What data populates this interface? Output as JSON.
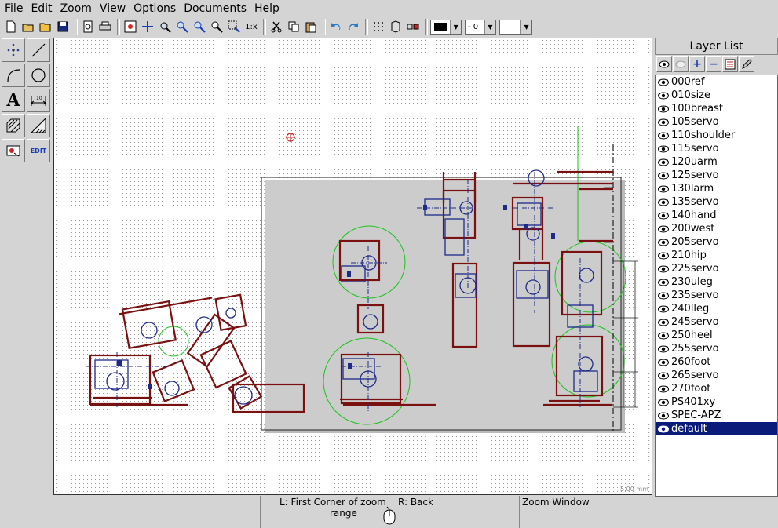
{
  "menu": [
    "File",
    "Edit",
    "Zoom",
    "View",
    "Options",
    "Documents",
    "Help"
  ],
  "toolbar": {
    "zoom_ratio_label": "1:x",
    "line_width_value": "0",
    "icons": [
      "new-icon",
      "open-icon",
      "open-folder-icon",
      "save-icon",
      "print-preview-icon",
      "print-icon",
      "zoom-auto-icon",
      "zoom-pan-icon",
      "zoom-page-icon",
      "zoom-in-icon",
      "zoom-out-icon",
      "zoom-window-icon",
      "zoom-previous-icon",
      "zoom-ratio-icon",
      "cut-icon",
      "copy-icon",
      "paste-icon",
      "undo-icon",
      "redo-icon",
      "grid-icon",
      "draft-icon",
      "snap-icon"
    ]
  },
  "tools": {
    "edit_label": "EDIT",
    "text_label": "A",
    "items": [
      "points-tool",
      "line-tool",
      "arc-tool",
      "circle-tool",
      "text-tool",
      "dimension-tool",
      "hatch-tool",
      "measure-tool",
      "block-tool",
      "edit-tool"
    ]
  },
  "canvas": {
    "scale_label": "5.00 mm",
    "colors": {
      "entity": "#7b1010",
      "detail": "#1e2a8a",
      "construction": "#19c419",
      "frame": "#222222"
    }
  },
  "layer_panel": {
    "title": "Layer List",
    "tool_icons": [
      "show-all-icon",
      "hide-all-icon",
      "add-layer-icon",
      "remove-layer-icon",
      "layer-properties-icon",
      "edit-layer-icon"
    ],
    "layers": [
      "000ref",
      "010size",
      "100breast",
      "105servo",
      "110shoulder",
      "115servo",
      "120uarm",
      "125servo",
      "130larm",
      "135servo",
      "140hand",
      "200west",
      "205servo",
      "210hip",
      "225servo",
      "230uleg",
      "235servo",
      "240lleg",
      "245servo",
      "250heel",
      "255servo",
      "260foot",
      "265servo",
      "270foot",
      "PS401xy",
      "SPEC-APZ",
      "default"
    ],
    "selected": "default"
  },
  "status": {
    "left_button": "L: First Corner of zoom",
    "left_button_cont": "range",
    "right_button": "R: Back",
    "command": "Zoom Window"
  }
}
